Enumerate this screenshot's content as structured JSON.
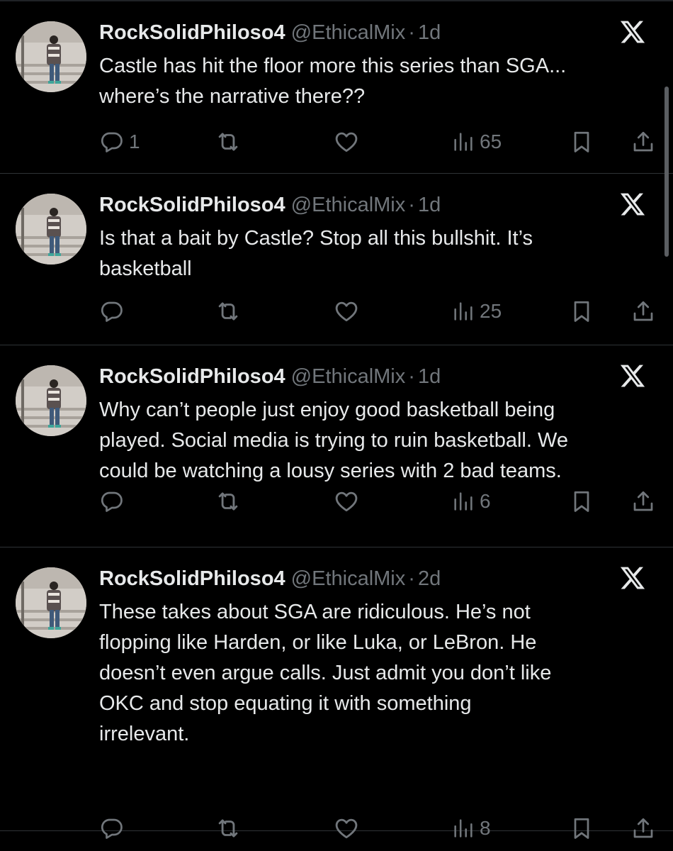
{
  "tweets": [
    {
      "display_name": "RockSolidPhiloso4",
      "handle": "@EthicalMix",
      "separator": "·",
      "time": "1d",
      "text": "Castle has hit the floor more this series than SGA...\nwhere’s the narrative there??",
      "replies": "1",
      "reposts": "",
      "likes": "",
      "views": "65"
    },
    {
      "display_name": "RockSolidPhiloso4",
      "handle": "@EthicalMix",
      "separator": "·",
      "time": "1d",
      "text": "Is that a bait by Castle? Stop all this bullshit. It’s\nbasketball",
      "replies": "",
      "reposts": "",
      "likes": "",
      "views": "25"
    },
    {
      "display_name": "RockSolidPhiloso4",
      "handle": "@EthicalMix",
      "separator": "·",
      "time": "1d",
      "text": "Why can’t people just enjoy good basketball being\nplayed. Social media is trying to ruin basketball. We\ncould be watching a lousy series with 2 bad teams.",
      "replies": "",
      "reposts": "",
      "likes": "",
      "views": "6"
    },
    {
      "display_name": "RockSolidPhiloso4",
      "handle": "@EthicalMix",
      "separator": "·",
      "time": "2d",
      "text": "These takes about SGA are ridiculous. He’s not\nflopping like Harden, or like Luka, or LeBron. He\ndoesn’t even argue calls. Just admit you don’t like\nOKC and stop equating it with something\nirrelevant.",
      "replies": "",
      "reposts": "",
      "likes": "",
      "views": "8"
    }
  ],
  "icons": {
    "reply": "reply-icon",
    "repost": "repost-icon",
    "like": "like-icon",
    "views": "views-icon",
    "bookmark": "bookmark-icon",
    "share": "share-icon",
    "platform": "x-logo-icon"
  },
  "colors": {
    "background": "#000000",
    "primary_text": "#e7e9ea",
    "secondary_text": "#71767b",
    "divider": "#2f3336"
  }
}
